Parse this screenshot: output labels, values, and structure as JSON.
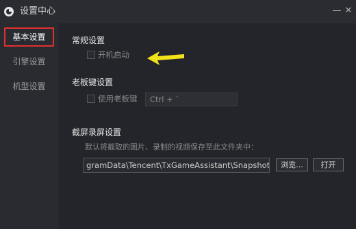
{
  "window": {
    "title": "设置中心",
    "minimize_icon": "minimize-icon",
    "close_icon": "close-icon",
    "logo": "app-logo-icon"
  },
  "sidebar": {
    "items": [
      {
        "label": "基本设置",
        "active": true
      },
      {
        "label": "引擎设置",
        "active": false
      },
      {
        "label": "机型设置",
        "active": false
      }
    ],
    "active_border_color": "#e03030"
  },
  "general": {
    "title": "常规设置",
    "autostart_label": "开机启动",
    "autostart_checked": false
  },
  "bosskey": {
    "title": "老板键设置",
    "use_label": "使用老板键",
    "use_checked": false,
    "hotkey_value": "Ctrl + `"
  },
  "screenshot": {
    "title": "截屏录屏设置",
    "description": "默认将截取的图片、录制的视频保存至此文件夹中：",
    "path_value": "gramData\\Tencent\\TxGameAssistant\\Snapshot",
    "browse_label": "浏览...",
    "open_label": "打开"
  },
  "annotation": {
    "arrow_color": "#f2e21a",
    "arrow_icon": "yellow-arrow-icon"
  }
}
